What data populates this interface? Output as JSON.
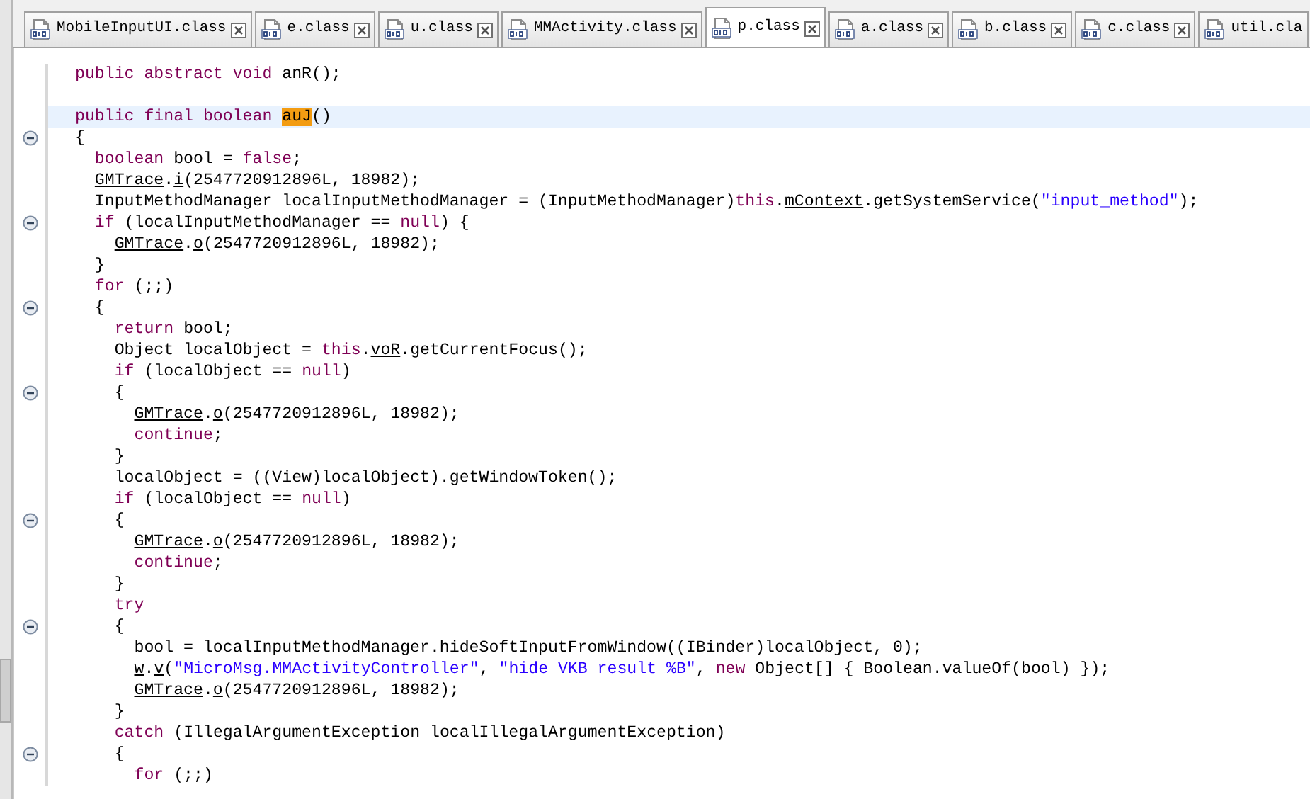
{
  "tabs": [
    {
      "label": "MobileInputUI.class",
      "selected": false
    },
    {
      "label": "e.class",
      "selected": false
    },
    {
      "label": "u.class",
      "selected": false
    },
    {
      "label": "MMActivity.class",
      "selected": false
    },
    {
      "label": "p.class",
      "selected": true
    },
    {
      "label": "a.class",
      "selected": false
    },
    {
      "label": "b.class",
      "selected": false
    },
    {
      "label": "c.class",
      "selected": false
    },
    {
      "label": "util.cla",
      "selected": false
    }
  ],
  "code": {
    "lines": [
      {
        "fold": false,
        "current": false,
        "segments": [
          {
            "kind": "kw",
            "text": "public abstract void"
          },
          {
            "kind": "plain",
            "text": " anR();"
          }
        ]
      },
      {
        "fold": false,
        "current": false
      },
      {
        "fold": false,
        "current": true,
        "segments": [
          {
            "kind": "kw",
            "text": "public final boolean "
          },
          {
            "kind": "match",
            "text": "auJ"
          },
          {
            "kind": "plain",
            "text": "()"
          }
        ]
      },
      {
        "fold": true,
        "current": false,
        "segments": [
          {
            "kind": "plain",
            "text": "{"
          }
        ]
      },
      {
        "fold": false,
        "current": false,
        "segments": [
          {
            "kind": "kw",
            "text": "  boolean"
          },
          {
            "kind": "plain",
            "text": " bool = "
          },
          {
            "kind": "kw",
            "text": "false"
          },
          {
            "kind": "plain",
            "text": ";"
          }
        ]
      },
      {
        "fold": false,
        "current": false,
        "segments": [
          {
            "kind": "link",
            "text": "  GMTrace"
          },
          {
            "kind": "plain",
            "text": "."
          },
          {
            "kind": "link",
            "text": "i"
          },
          {
            "kind": "plain",
            "text": "(2547720912896L, 18982);"
          }
        ]
      },
      {
        "fold": false,
        "current": false,
        "segments": [
          {
            "kind": "plain",
            "text": "  InputMethodManager localInputMethodManager = (InputMethodManager)"
          },
          {
            "kind": "kw",
            "text": "this"
          },
          {
            "kind": "plain",
            "text": "."
          },
          {
            "kind": "link",
            "text": "mContext"
          },
          {
            "kind": "plain",
            "text": ".getSystemService("
          },
          {
            "kind": "str",
            "text": "\"input_method\""
          },
          {
            "kind": "plain",
            "text": ");"
          }
        ]
      },
      {
        "fold": true,
        "current": false,
        "segments": [
          {
            "kind": "kw",
            "text": "  if"
          },
          {
            "kind": "plain",
            "text": " (localInputMethodManager == "
          },
          {
            "kind": "kw",
            "text": "null"
          },
          {
            "kind": "plain",
            "text": ") {"
          }
        ]
      },
      {
        "fold": false,
        "current": false,
        "segments": [
          {
            "kind": "link",
            "text": "    GMTrace"
          },
          {
            "kind": "plain",
            "text": "."
          },
          {
            "kind": "link",
            "text": "o"
          },
          {
            "kind": "plain",
            "text": "(2547720912896L, 18982);"
          }
        ]
      },
      {
        "fold": false,
        "current": false,
        "segments": [
          {
            "kind": "plain",
            "text": "  }"
          }
        ]
      },
      {
        "fold": false,
        "current": false,
        "segments": [
          {
            "kind": "kw",
            "text": "  for"
          },
          {
            "kind": "plain",
            "text": " (;;)"
          }
        ]
      },
      {
        "fold": true,
        "current": false,
        "segments": [
          {
            "kind": "plain",
            "text": "  {"
          }
        ]
      },
      {
        "fold": false,
        "current": false,
        "segments": [
          {
            "kind": "kw",
            "text": "    return"
          },
          {
            "kind": "plain",
            "text": " bool;"
          }
        ]
      },
      {
        "fold": false,
        "current": false,
        "segments": [
          {
            "kind": "plain",
            "text": "    Object localObject = "
          },
          {
            "kind": "kw",
            "text": "this"
          },
          {
            "kind": "plain",
            "text": "."
          },
          {
            "kind": "link",
            "text": "voR"
          },
          {
            "kind": "plain",
            "text": ".getCurrentFocus();"
          }
        ]
      },
      {
        "fold": false,
        "current": false,
        "segments": [
          {
            "kind": "kw",
            "text": "    if"
          },
          {
            "kind": "plain",
            "text": " (localObject == "
          },
          {
            "kind": "kw",
            "text": "null"
          },
          {
            "kind": "plain",
            "text": ")"
          }
        ]
      },
      {
        "fold": true,
        "current": false,
        "segments": [
          {
            "kind": "plain",
            "text": "    {"
          }
        ]
      },
      {
        "fold": false,
        "current": false,
        "segments": [
          {
            "kind": "link",
            "text": "      GMTrace"
          },
          {
            "kind": "plain",
            "text": "."
          },
          {
            "kind": "link",
            "text": "o"
          },
          {
            "kind": "plain",
            "text": "(2547720912896L, 18982);"
          }
        ]
      },
      {
        "fold": false,
        "current": false,
        "segments": [
          {
            "kind": "kw",
            "text": "      continue"
          },
          {
            "kind": "plain",
            "text": ";"
          }
        ]
      },
      {
        "fold": false,
        "current": false,
        "segments": [
          {
            "kind": "plain",
            "text": "    }"
          }
        ]
      },
      {
        "fold": false,
        "current": false,
        "segments": [
          {
            "kind": "plain",
            "text": "    localObject = ((View)localObject).getWindowToken();"
          }
        ]
      },
      {
        "fold": false,
        "current": false,
        "segments": [
          {
            "kind": "kw",
            "text": "    if"
          },
          {
            "kind": "plain",
            "text": " (localObject == "
          },
          {
            "kind": "kw",
            "text": "null"
          },
          {
            "kind": "plain",
            "text": ")"
          }
        ]
      },
      {
        "fold": true,
        "current": false,
        "segments": [
          {
            "kind": "plain",
            "text": "    {"
          }
        ]
      },
      {
        "fold": false,
        "current": false,
        "segments": [
          {
            "kind": "link",
            "text": "      GMTrace"
          },
          {
            "kind": "plain",
            "text": "."
          },
          {
            "kind": "link",
            "text": "o"
          },
          {
            "kind": "plain",
            "text": "(2547720912896L, 18982);"
          }
        ]
      },
      {
        "fold": false,
        "current": false,
        "segments": [
          {
            "kind": "kw",
            "text": "      continue"
          },
          {
            "kind": "plain",
            "text": ";"
          }
        ]
      },
      {
        "fold": false,
        "current": false,
        "segments": [
          {
            "kind": "plain",
            "text": "    }"
          }
        ]
      },
      {
        "fold": false,
        "current": false,
        "segments": [
          {
            "kind": "kw",
            "text": "    try"
          }
        ]
      },
      {
        "fold": true,
        "current": false,
        "segments": [
          {
            "kind": "plain",
            "text": "    {"
          }
        ]
      },
      {
        "fold": false,
        "current": false,
        "segments": [
          {
            "kind": "plain",
            "text": "      bool = localInputMethodManager.hideSoftInputFromWindow((IBinder)localObject, 0);"
          }
        ]
      },
      {
        "fold": false,
        "current": false,
        "segments": [
          {
            "kind": "link",
            "text": "      w"
          },
          {
            "kind": "plain",
            "text": "."
          },
          {
            "kind": "link",
            "text": "v"
          },
          {
            "kind": "plain",
            "text": "("
          },
          {
            "kind": "str",
            "text": "\"MicroMsg.MMActivityController\""
          },
          {
            "kind": "plain",
            "text": ", "
          },
          {
            "kind": "str",
            "text": "\"hide VKB result %B\""
          },
          {
            "kind": "plain",
            "text": ", "
          },
          {
            "kind": "kw",
            "text": "new"
          },
          {
            "kind": "plain",
            "text": " Object[] { Boolean.valueOf(bool) });"
          }
        ]
      },
      {
        "fold": false,
        "current": false,
        "segments": [
          {
            "kind": "link",
            "text": "      GMTrace"
          },
          {
            "kind": "plain",
            "text": "."
          },
          {
            "kind": "link",
            "text": "o"
          },
          {
            "kind": "plain",
            "text": "(2547720912896L, 18982);"
          }
        ]
      },
      {
        "fold": false,
        "current": false,
        "segments": [
          {
            "kind": "plain",
            "text": "    }"
          }
        ]
      },
      {
        "fold": false,
        "current": false,
        "segments": [
          {
            "kind": "kw",
            "text": "    catch"
          },
          {
            "kind": "plain",
            "text": " (IllegalArgumentException localIllegalArgumentException)"
          }
        ]
      },
      {
        "fold": true,
        "current": false,
        "segments": [
          {
            "kind": "plain",
            "text": "    {"
          }
        ]
      },
      {
        "fold": false,
        "current": false,
        "segments": [
          {
            "kind": "kw",
            "text": "      for"
          },
          {
            "kind": "plain",
            "text": " (;;)"
          }
        ]
      }
    ]
  }
}
